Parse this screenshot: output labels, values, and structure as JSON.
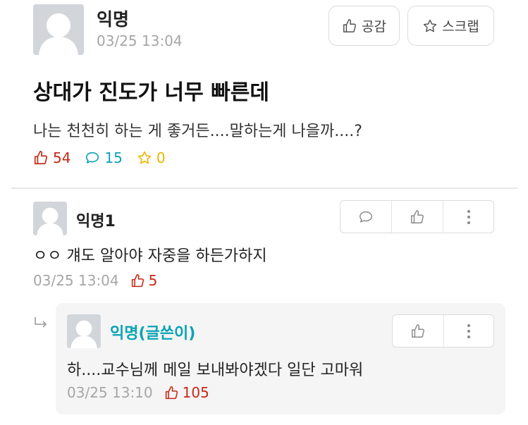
{
  "post": {
    "author": "익명",
    "time": "03/25 13:04",
    "title": "상대가 진도가 너무 빠른데",
    "body": "나는 천천히 하는 게 좋거든....말하는게 나을까....?",
    "like_count": "54",
    "comment_count": "15",
    "scrap_count": "0",
    "empathy_label": "공감",
    "scrap_label": "스크랩"
  },
  "comments": [
    {
      "author": "익명1",
      "text": "ㅇㅇ 걔도 알아야 자중을 하든가하지",
      "time": "03/25 13:04",
      "likes": "5"
    }
  ],
  "replies": [
    {
      "author": "익명(글쓴이)",
      "text": "하....교수님께 메일 보내봐야겠다 일단 고마워",
      "time": "03/25 13:10",
      "likes": "105"
    }
  ],
  "colors": {
    "like_red": "#c62917",
    "comment_teal": "#0da3b5",
    "scrap_yellow": "#f0b400",
    "op_teal": "#0aa3b4",
    "meta_gray": "#a6a6a6"
  }
}
